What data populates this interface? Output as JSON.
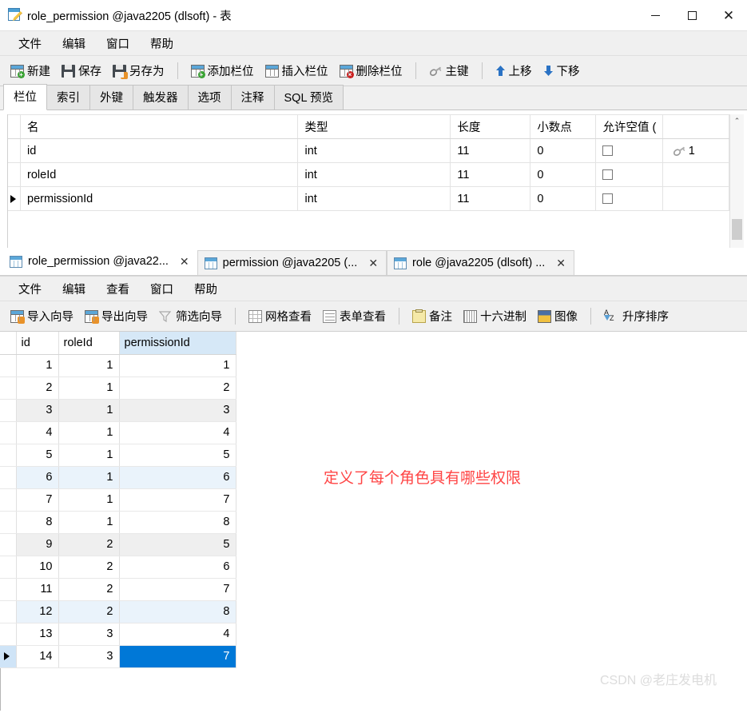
{
  "window": {
    "title": "role_permission @java2205 (dlsoft) - 表",
    "icon": "table-edit-icon",
    "controls": {
      "minimize": "minimize-icon",
      "maximize": "maximize-icon",
      "close": "close-icon"
    }
  },
  "menu_main": [
    "文件",
    "编辑",
    "窗口",
    "帮助"
  ],
  "toolbar_main": [
    {
      "label": "新建",
      "icon": "new-table-icon"
    },
    {
      "label": "保存",
      "icon": "save-icon"
    },
    {
      "label": "另存为",
      "icon": "save-as-icon"
    },
    {
      "sep": true
    },
    {
      "label": "添加栏位",
      "icon": "add-field-icon"
    },
    {
      "label": "插入栏位",
      "icon": "insert-field-icon"
    },
    {
      "label": "删除栏位",
      "icon": "delete-field-icon"
    },
    {
      "sep": true
    },
    {
      "label": "主键",
      "icon": "key-icon"
    },
    {
      "sep": true
    },
    {
      "label": "上移",
      "icon": "arrow-up-icon"
    },
    {
      "label": "下移",
      "icon": "arrow-down-icon"
    }
  ],
  "design_tabs": [
    {
      "label": "栏位",
      "active": true
    },
    {
      "label": "索引",
      "active": false
    },
    {
      "label": "外键",
      "active": false
    },
    {
      "label": "触发器",
      "active": false
    },
    {
      "label": "选项",
      "active": false
    },
    {
      "label": "注释",
      "active": false
    },
    {
      "label": "SQL 预览",
      "active": false
    }
  ],
  "design_grid": {
    "columns": [
      "名",
      "类型",
      "长度",
      "小数点",
      "允许空值 (",
      ""
    ],
    "rows": [
      {
        "marker": "",
        "name": "id",
        "type": "int",
        "length": "11",
        "decimals": "0",
        "nullable": false,
        "key": "1"
      },
      {
        "marker": "",
        "name": "roleId",
        "type": "int",
        "length": "11",
        "decimals": "0",
        "nullable": false,
        "key": ""
      },
      {
        "marker": "▶",
        "name": "permissionId",
        "type": "int",
        "length": "11",
        "decimals": "0",
        "nullable": false,
        "key": ""
      }
    ]
  },
  "sub_tabs": [
    {
      "label": "role_permission @java22...",
      "active": true,
      "close": "✕"
    },
    {
      "label": "permission @java2205 (...",
      "active": false,
      "close": "✕"
    },
    {
      "label": "role @java2205 (dlsoft) ...",
      "active": false,
      "close": "✕"
    }
  ],
  "menu_sub": [
    "文件",
    "编辑",
    "查看",
    "窗口",
    "帮助"
  ],
  "toolbar_sub": [
    {
      "label": "导入向导",
      "icon": "import-wizard-icon"
    },
    {
      "label": "导出向导",
      "icon": "export-wizard-icon"
    },
    {
      "label": "筛选向导",
      "icon": "filter-wizard-icon"
    },
    {
      "sep": true
    },
    {
      "label": "网格查看",
      "icon": "grid-view-icon"
    },
    {
      "label": "表单查看",
      "icon": "form-view-icon"
    },
    {
      "sep": true
    },
    {
      "label": "备注",
      "icon": "note-icon"
    },
    {
      "label": "十六进制",
      "icon": "hex-icon"
    },
    {
      "label": "图像",
      "icon": "image-icon"
    },
    {
      "sep": true
    },
    {
      "label": "升序排序",
      "icon": "sort-ascending-icon"
    }
  ],
  "data_grid": {
    "columns": [
      {
        "label": "id",
        "highlight": false
      },
      {
        "label": "roleId",
        "highlight": false
      },
      {
        "label": "permissionId",
        "highlight": true
      }
    ],
    "rows": [
      {
        "marker": "",
        "id": "1",
        "roleId": "1",
        "permissionId": "1",
        "style": ""
      },
      {
        "marker": "",
        "id": "2",
        "roleId": "1",
        "permissionId": "2",
        "style": ""
      },
      {
        "marker": "",
        "id": "3",
        "roleId": "1",
        "permissionId": "3",
        "style": "alt"
      },
      {
        "marker": "",
        "id": "4",
        "roleId": "1",
        "permissionId": "4",
        "style": ""
      },
      {
        "marker": "",
        "id": "5",
        "roleId": "1",
        "permissionId": "5",
        "style": ""
      },
      {
        "marker": "",
        "id": "6",
        "roleId": "1",
        "permissionId": "6",
        "style": "hov"
      },
      {
        "marker": "",
        "id": "7",
        "roleId": "1",
        "permissionId": "7",
        "style": ""
      },
      {
        "marker": "",
        "id": "8",
        "roleId": "1",
        "permissionId": "8",
        "style": ""
      },
      {
        "marker": "",
        "id": "9",
        "roleId": "2",
        "permissionId": "5",
        "style": "alt"
      },
      {
        "marker": "",
        "id": "10",
        "roleId": "2",
        "permissionId": "6",
        "style": ""
      },
      {
        "marker": "",
        "id": "11",
        "roleId": "2",
        "permissionId": "7",
        "style": ""
      },
      {
        "marker": "",
        "id": "12",
        "roleId": "2",
        "permissionId": "8",
        "style": "hov"
      },
      {
        "marker": "",
        "id": "13",
        "roleId": "3",
        "permissionId": "4",
        "style": ""
      },
      {
        "marker": "▶",
        "id": "14",
        "roleId": "3",
        "permissionId": "7",
        "style": "current",
        "selected_cell": "permissionId"
      }
    ]
  },
  "annotation": {
    "text": "定义了每个角色具有哪些权限",
    "color": "#ff4444"
  },
  "watermark": {
    "text": "CSDN @老庄发电机",
    "color": "#dcdcdc"
  }
}
